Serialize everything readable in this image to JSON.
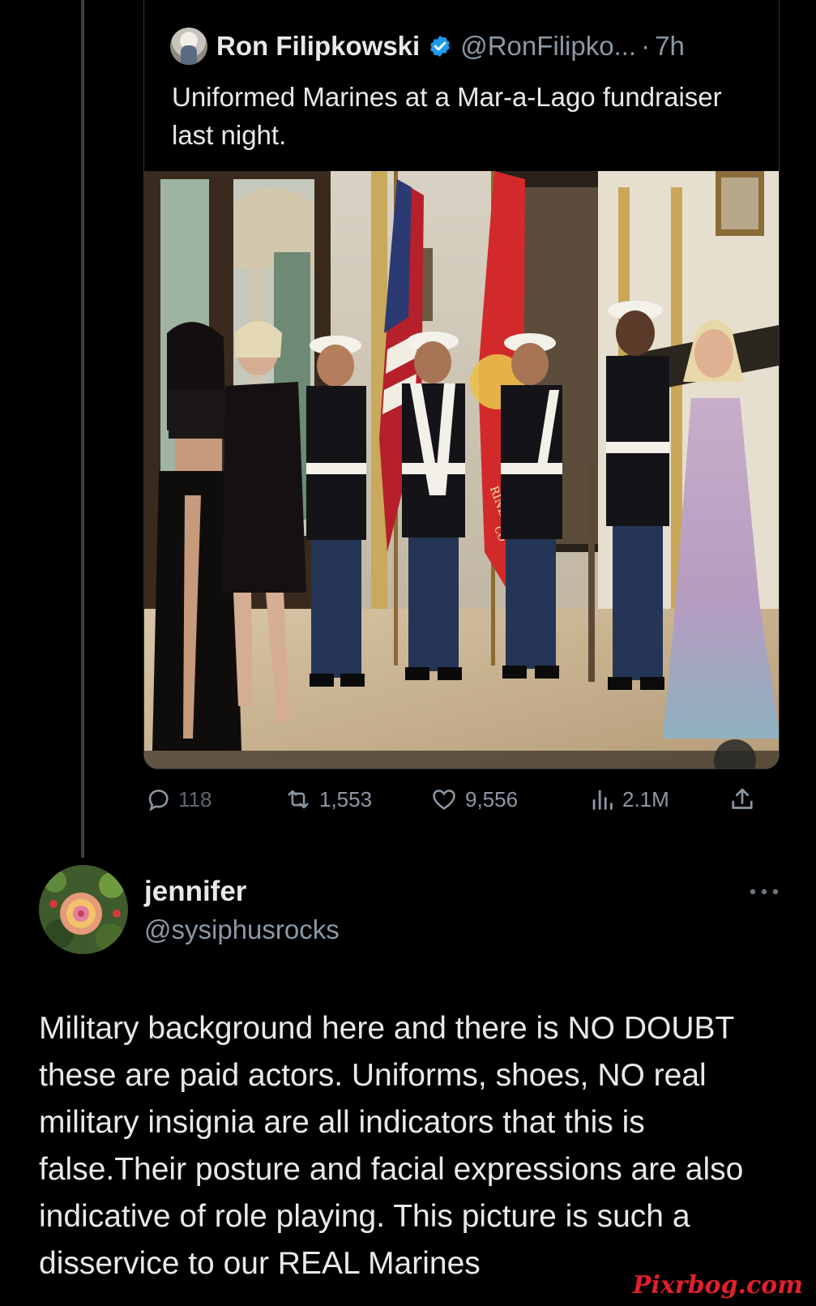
{
  "quoted_tweet": {
    "author_name": "Ron Filipkowski",
    "handle": "@RonFilipko...",
    "separator": "·",
    "time": "7h",
    "text": "Uniformed Marines at a Mar-a-Lago fundraiser last night.",
    "media": {
      "flag_text": [
        "RINE",
        "CO"
      ]
    }
  },
  "actions": {
    "replies": "118",
    "reposts": "1,553",
    "likes": "9,556",
    "views": "2.1M"
  },
  "reply": {
    "author_name": "jennifer",
    "handle": "@sysiphusrocks",
    "text": "Military background here and there is NO DOUBT these are paid actors.  Uniforms, shoes, NO real military insignia are all indicators that this is false.Their posture and facial expressions are also indicative of role playing.  This picture is such a disservice to our REAL Marines"
  },
  "watermark": "Pixrbog.com",
  "colors": {
    "background": "#000000",
    "text_primary": "#e7e9ea",
    "text_secondary": "#8b98a5",
    "verified_blue": "#1d9bf0",
    "watermark_red": "#e0202a"
  },
  "icons": [
    "verified-badge-icon",
    "reply-icon",
    "repost-icon",
    "like-icon",
    "views-icon",
    "share-icon",
    "more-icon",
    "mute-icon"
  ]
}
